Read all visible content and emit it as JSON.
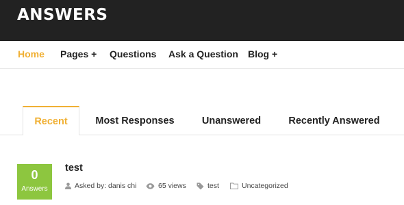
{
  "header": {
    "logo": "ANSWERS"
  },
  "nav": {
    "items": [
      {
        "label": "Home"
      },
      {
        "label": "Pages +"
      },
      {
        "label": "Questions"
      },
      {
        "label": "Ask a Question"
      },
      {
        "label": "Blog +"
      }
    ]
  },
  "tabs": [
    {
      "label": "Recent"
    },
    {
      "label": "Most Responses"
    },
    {
      "label": "Unanswered"
    },
    {
      "label": "Recently Answered"
    }
  ],
  "question": {
    "answers_count": "0",
    "answers_label": "Answers",
    "title": "test",
    "asked_by": "Asked by: danis chi",
    "views": "65 views",
    "tag": "test",
    "category": "Uncategorized"
  },
  "colors": {
    "accent": "#f0b034",
    "answer_badge": "#8dc63f",
    "header_bg": "#222222"
  },
  "icons": [
    "user-icon",
    "eye-icon",
    "tag-icon",
    "folder-icon"
  ]
}
